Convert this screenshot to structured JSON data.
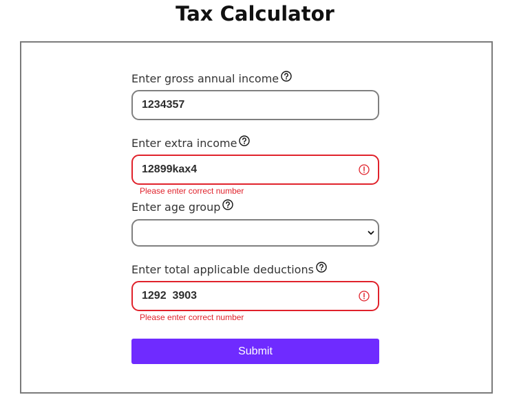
{
  "page": {
    "title": "Tax Calculator"
  },
  "form": {
    "gross_income": {
      "label": "Enter gross annual income",
      "value": "1234357"
    },
    "extra_income": {
      "label": "Enter extra income",
      "value": "12899kax4",
      "error": "Please enter correct number"
    },
    "age_group": {
      "label": "Enter age group",
      "selected": ""
    },
    "deductions": {
      "label": "Enter total applicable deductions",
      "value": "1292  3903",
      "error": "Please enter correct number"
    },
    "submit_label": "Submit"
  },
  "colors": {
    "accent": "#6f2bff",
    "error": "#e0212a",
    "border": "#7f7f7f"
  },
  "icons": {
    "help": "question-circle-icon",
    "error": "exclamation-circle-icon",
    "dropdown": "chevron-down-icon"
  }
}
